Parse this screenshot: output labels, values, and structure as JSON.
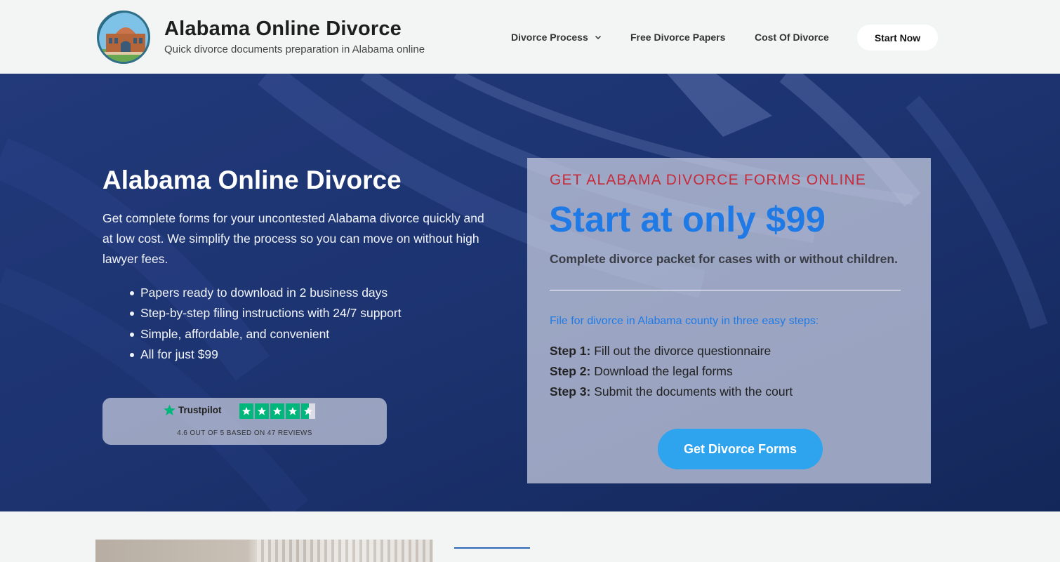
{
  "header": {
    "site_title": "Alabama Online Divorce",
    "tagline": "Quick divorce documents preparation in Alabama online",
    "nav": [
      {
        "label": "Divorce Process",
        "has_dropdown": true
      },
      {
        "label": "Free Divorce Papers",
        "has_dropdown": false
      },
      {
        "label": "Cost Of Divorce",
        "has_dropdown": false
      }
    ],
    "cta_label": "Start Now"
  },
  "hero": {
    "title": "Alabama Online Divorce",
    "description": "Get complete forms for your uncontested Alabama divorce quickly and at low cost. We simplify the process so you can move on without high lawyer fees.",
    "bullets": [
      "Papers ready to download in 2 business days",
      "Step-by-step filing instructions with 24/7 support",
      "Simple, affordable, and convenient",
      "All for just $99"
    ],
    "trustpilot": {
      "brand": "Trustpilot",
      "rating": 4.6,
      "rating_text": "4.6 OUT OF 5 BASED ON 47 REVIEWS",
      "star_color": "#00b67a"
    }
  },
  "card": {
    "eyebrow": "GET ALABAMA DIVORCE FORMS ONLINE",
    "price_headline": "Start at only $99",
    "subtitle": "Complete divorce packet for cases with or without children.",
    "steps_title": "File for divorce in Alabama county in three easy steps:",
    "steps": [
      {
        "label": "Step 1:",
        "text": "Fill out the divorce questionnaire"
      },
      {
        "label": "Step 2:",
        "text": "Download the legal forms"
      },
      {
        "label": "Step 3:",
        "text": "Submit the documents with the court"
      }
    ],
    "button_label": "Get Divorce Forms"
  },
  "colors": {
    "hero_bg": "#1a2f66",
    "accent_red": "#c62b3b",
    "accent_blue": "#1f7ae6",
    "button_blue": "#2ea3ee"
  }
}
